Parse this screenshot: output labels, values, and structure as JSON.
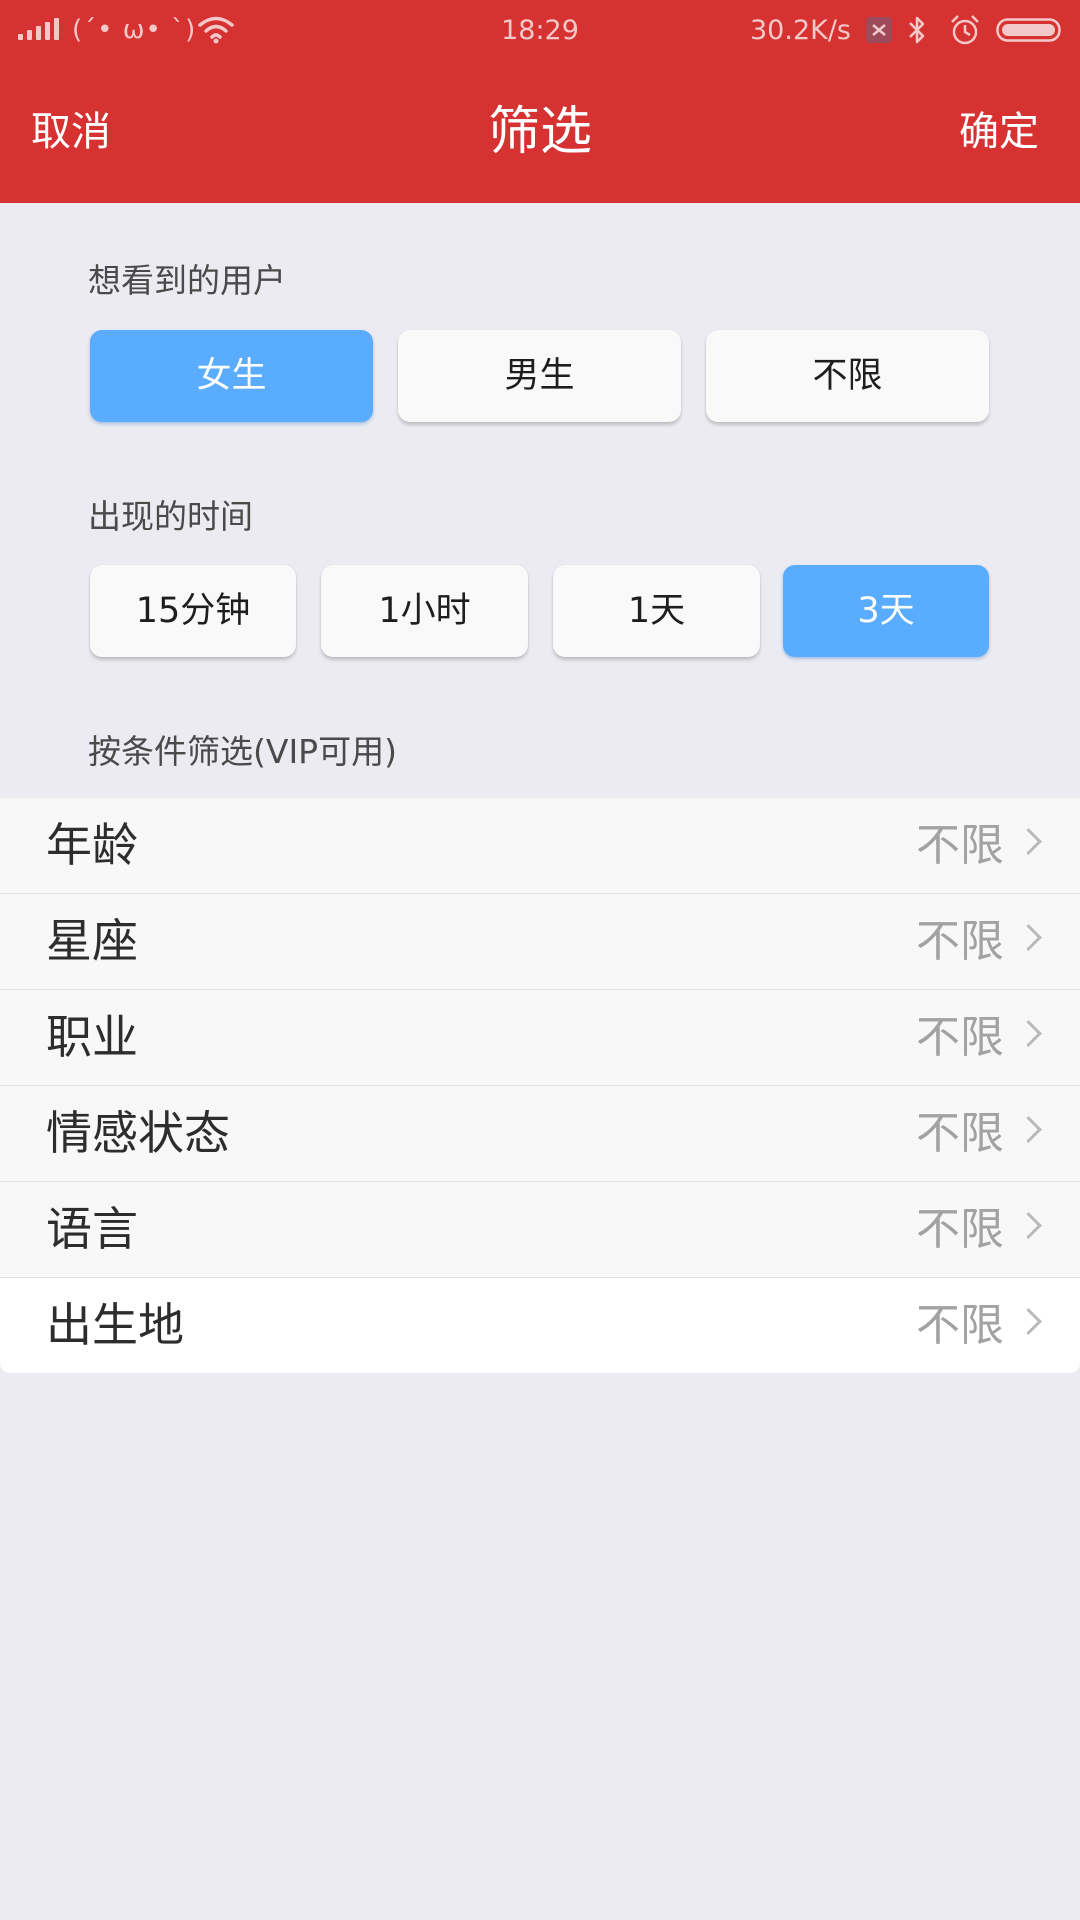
{
  "status_bar": {
    "kaomoji": "(´• ω• `)",
    "time": "18:29",
    "net_speed": "30.2K/s",
    "icons": [
      "signal-icon",
      "wifi-icon",
      "sim-card-icon",
      "bluetooth-icon",
      "alarm-icon",
      "battery-icon"
    ]
  },
  "nav": {
    "cancel": "取消",
    "title": "筛选",
    "confirm": "确定"
  },
  "gender_section": {
    "label": "想看到的用户",
    "options": [
      "女生",
      "男生",
      "不限"
    ],
    "selected": "女生"
  },
  "time_section": {
    "label": "出现的时间",
    "options": [
      "15分钟",
      "1小时",
      "1天",
      "3天"
    ],
    "selected": "3天"
  },
  "condition_section": {
    "label": "按条件筛选(VIP可用)"
  },
  "filters": [
    {
      "label": "年龄",
      "value": "不限"
    },
    {
      "label": "星座",
      "value": "不限"
    },
    {
      "label": "职业",
      "value": "不限"
    },
    {
      "label": "情感状态",
      "value": "不限"
    },
    {
      "label": "语言",
      "value": "不限"
    },
    {
      "label": "出生地",
      "value": "不限"
    }
  ],
  "colors": {
    "header": "#d63232",
    "selected_option": "#5aacff",
    "background": "#ebebf1"
  }
}
